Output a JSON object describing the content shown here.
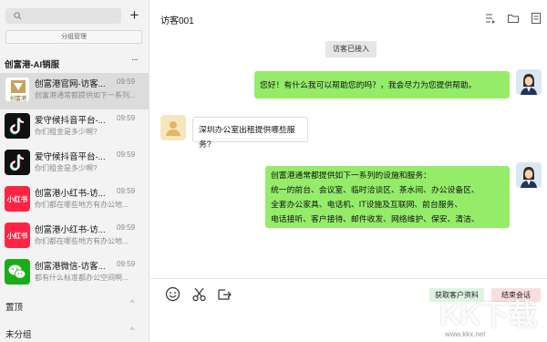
{
  "sidebar": {
    "search": {
      "placeholder": ""
    },
    "add_label": "+",
    "group_mgmt_label": "分组管理",
    "section_title": "创富港-AI销服",
    "section_more": "···",
    "conversations": [
      {
        "name": "创富港官网-访客...",
        "time": "09:59",
        "message": "创富港通常都提供如下一系列...",
        "avatar": "cfg-logo",
        "active": true
      },
      {
        "name": "爱守候抖音平台-...",
        "time": "09:59",
        "message": "你们租金是多少啊?",
        "avatar": "tiktok",
        "active": false
      },
      {
        "name": "爱守候抖音平台-...",
        "time": "09:59",
        "message": "你们租金是多少啊?",
        "avatar": "tiktok",
        "active": false
      },
      {
        "name": "创富港小红书-访...",
        "time": "09:59",
        "message": "你们都在哪些地方有办公地...",
        "avatar": "xiaohongshu",
        "active": false
      },
      {
        "name": "创富港小红书-访...",
        "time": "09:59",
        "message": "你们都在哪些地方有办公地...",
        "avatar": "xiaohongshu",
        "active": false
      },
      {
        "name": "创富港微信-访客...",
        "time": "09:59",
        "message": "都有什么标准都办公空间啊...",
        "avatar": "wechat",
        "active": false
      }
    ],
    "avatar_text": {
      "cfg": "创富港",
      "xhs": "小红书"
    },
    "groups": [
      {
        "label": "置顶",
        "chevron": "^"
      },
      {
        "label": "未分组",
        "chevron": "^"
      }
    ]
  },
  "header": {
    "title": "访客001"
  },
  "chat": {
    "system_tag": "访客已接入",
    "messages": [
      {
        "side": "right",
        "lines": [
          "您好！有什么我可以帮助您的吗？，我会尽力为您提供帮助。"
        ]
      },
      {
        "side": "left",
        "lines": [
          "深圳办公室出租提供哪些服务?"
        ]
      },
      {
        "side": "right",
        "lines": [
          "创富港通常都提供如下一系列的设施和服务：",
          "统一的前台、会议室、临时洽谈区、茶水间、办公设备区、",
          "全套办公家具、电话机、IT设施及互联网、前台服务、",
          "电话接听、客户接待、邮件收发、网络维护、保安、清洁、"
        ]
      }
    ]
  },
  "composer": {
    "fetch_label": "获取客户资料",
    "end_label": "结束会话"
  },
  "watermark": {
    "main": "KK下载",
    "url": "www.kkx.net"
  },
  "colors": {
    "bubble_right": "#95ec69",
    "tiktok_bg": "#111111",
    "xhs_red": "#ff2442",
    "wechat_green": "#1aad19"
  }
}
